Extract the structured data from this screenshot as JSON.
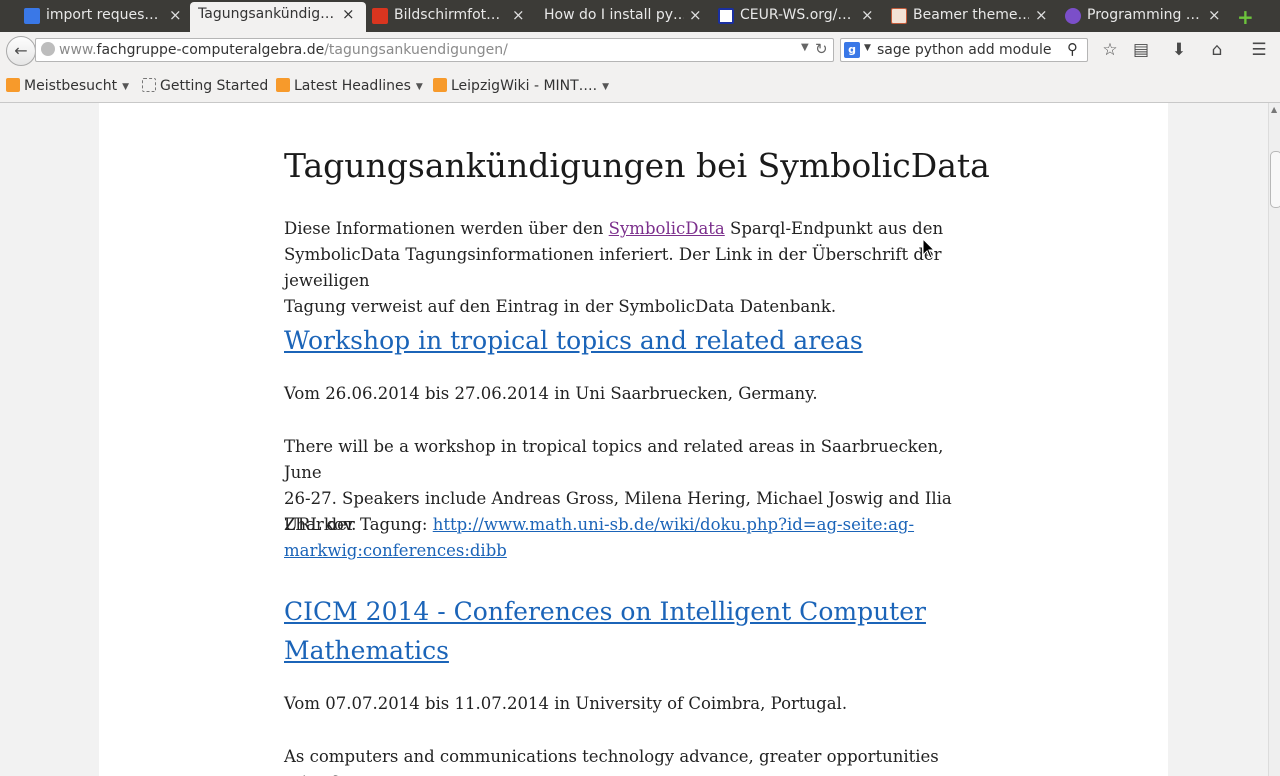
{
  "tabs": [
    {
      "title": "import reques…",
      "icon": "google-icon",
      "icon_color": "#3a78e7"
    },
    {
      "title": "Tagungsankündig…",
      "icon": "none",
      "active": true
    },
    {
      "title": "Bildschirmfot…",
      "icon": "bookmark-red-icon",
      "icon_color": "#d9351f"
    },
    {
      "title": "How do I install py…",
      "icon": "none"
    },
    {
      "title": "CEUR-WS.org/…",
      "icon": "ceur-icon",
      "icon_color": "#1a2fa0"
    },
    {
      "title": "Beamer theme…",
      "icon": "page-icon",
      "icon_color": "#c25b3a"
    },
    {
      "title": "Programming …",
      "icon": "globe-purple-icon",
      "icon_color": "#7b4fc9"
    }
  ],
  "new_tab_symbol": "+",
  "close_symbol": "×",
  "navbar": {
    "back_symbol": "←",
    "url_prefix": "www.",
    "url_domain": "fachgruppe-computeralgebra.de",
    "url_path": "/tagungsankuendigungen/",
    "search_engine_letter": "g",
    "search_text": "sage python add module"
  },
  "bookmarks": [
    {
      "label": "Meistbesucht",
      "icon": "rss-folder-icon",
      "dropdown": true
    },
    {
      "label": "Getting Started",
      "icon": "blank-page-icon",
      "dropdown": false
    },
    {
      "label": "Latest Headlines",
      "icon": "rss-icon",
      "dropdown": true
    },
    {
      "label": "LeipzigWiki - MINT….",
      "icon": "rss-icon",
      "dropdown": true
    }
  ],
  "content": {
    "heading": "Tagungsankündigungen bei SymbolicData",
    "intro_before": "Diese Informationen werden über den ",
    "intro_link": "SymbolicData",
    "intro_line1_after": " Sparql-Endpunkt aus den",
    "intro_line2": "SymbolicData Tagungsinformationen inferiert. Der Link in der Überschrift der jeweiligen",
    "intro_line3": "Tagung verweist auf den Eintrag in der SymbolicData Datenbank.",
    "events": [
      {
        "title": "Workshop in tropical topics and related areas",
        "dates": "Vom 26.06.2014 bis 27.06.2014 in Uni Saarbruecken, Germany.",
        "desc_line1": "There will be a workshop in tropical topics and related areas in Saarbruecken, June",
        "desc_line2": "26-27. Speakers include Andreas Gross, Milena Hering, Michael Joswig and Ilia Zharkov.",
        "url_label": "URL der Tagung: ",
        "url_line1": "http://www.math.uni-sb.de/wiki/doku.php?id=ag-seite:ag-",
        "url_line2": "markwig:conferences:dibb"
      },
      {
        "title_line1": "CICM 2014 - Conferences on Intelligent Computer",
        "title_line2": "Mathematics",
        "dates": "Vom 07.07.2014 bis 11.07.2014 in University of Coimbra, Portugal.",
        "desc_line1": "As computers and communications technology advance, greater opportunities arise for"
      }
    ]
  },
  "colors": {
    "link": "#1b64b8",
    "visited_link": "#7b2f8c",
    "tabstrip": "#3c3b37",
    "new_tab": "#6dc43c"
  }
}
